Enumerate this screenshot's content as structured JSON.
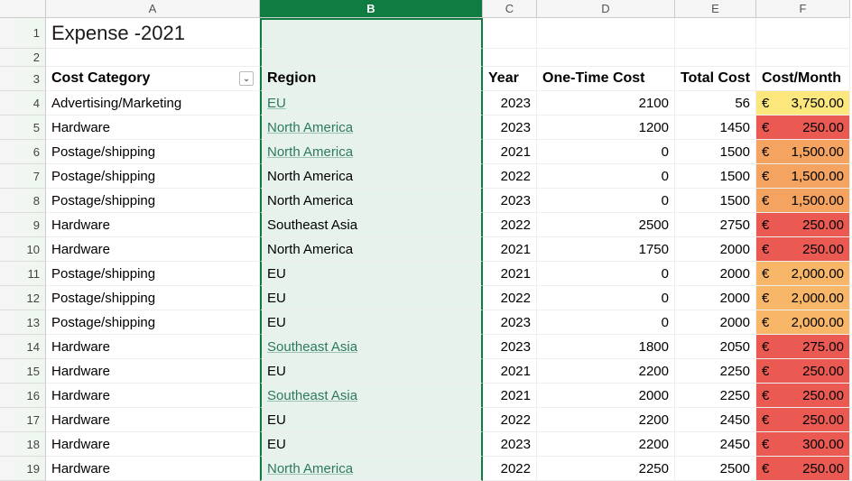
{
  "columns": [
    "A",
    "B",
    "C",
    "D",
    "E",
    "F"
  ],
  "title": "Expense -2021",
  "headers": {
    "costCategory": "Cost Category",
    "region": "Region",
    "year": "Year",
    "oneTimeCost": "One-Time Cost",
    "totalCost": "Total Cost",
    "costMonth": "Cost/Month"
  },
  "currencySymbol": "€",
  "rows": [
    {
      "n": 4,
      "cat": "Advertising/Marketing",
      "region": "EU ",
      "link": true,
      "year": 2023,
      "otc": 2100,
      "tc": 56,
      "cm": "3,750.00",
      "bg": "#fce77d"
    },
    {
      "n": 5,
      "cat": "Hardware",
      "region": "North America ",
      "link": true,
      "year": 2023,
      "otc": 1200,
      "tc": 1450,
      "cm": "250.00",
      "bg": "#ea5a53"
    },
    {
      "n": 6,
      "cat": "Postage/shipping",
      "region": "North America ",
      "link": true,
      "year": 2021,
      "otc": 0,
      "tc": 1500,
      "cm": "1,500.00",
      "bg": "#f4a460"
    },
    {
      "n": 7,
      "cat": "Postage/shipping",
      "region": "North America",
      "link": false,
      "year": 2022,
      "otc": 0,
      "tc": 1500,
      "cm": "1,500.00",
      "bg": "#f4a460"
    },
    {
      "n": 8,
      "cat": "Postage/shipping",
      "region": "North America",
      "link": false,
      "year": 2023,
      "otc": 0,
      "tc": 1500,
      "cm": "1,500.00",
      "bg": "#f4a460"
    },
    {
      "n": 9,
      "cat": "Hardware",
      "region": "Southeast Asia",
      "link": false,
      "year": 2022,
      "otc": 2500,
      "tc": 2750,
      "cm": "250.00",
      "bg": "#ea5a53"
    },
    {
      "n": 10,
      "cat": "Hardware",
      "region": "North America",
      "link": false,
      "year": 2021,
      "otc": 1750,
      "tc": 2000,
      "cm": "250.00",
      "bg": "#ea5a53"
    },
    {
      "n": 11,
      "cat": "Postage/shipping",
      "region": "EU",
      "link": false,
      "year": 2021,
      "otc": 0,
      "tc": 2000,
      "cm": "2,000.00",
      "bg": "#f8b768"
    },
    {
      "n": 12,
      "cat": "Postage/shipping",
      "region": "EU",
      "link": false,
      "year": 2022,
      "otc": 0,
      "tc": 2000,
      "cm": "2,000.00",
      "bg": "#f8b768"
    },
    {
      "n": 13,
      "cat": "Postage/shipping",
      "region": "EU",
      "link": false,
      "year": 2023,
      "otc": 0,
      "tc": 2000,
      "cm": "2,000.00",
      "bg": "#f8b768"
    },
    {
      "n": 14,
      "cat": "Hardware",
      "region": "Southeast Asia ",
      "link": true,
      "year": 2023,
      "otc": 1800,
      "tc": 2050,
      "cm": "275.00",
      "bg": "#ea5a53"
    },
    {
      "n": 15,
      "cat": "Hardware",
      "region": "EU",
      "link": false,
      "year": 2021,
      "otc": 2200,
      "tc": 2250,
      "cm": "250.00",
      "bg": "#ea5a53"
    },
    {
      "n": 16,
      "cat": "Hardware",
      "region": "Southeast Asia ",
      "link": true,
      "year": 2021,
      "otc": 2000,
      "tc": 2250,
      "cm": "250.00",
      "bg": "#ea5a53"
    },
    {
      "n": 17,
      "cat": "Hardware",
      "region": "EU",
      "link": false,
      "year": 2022,
      "otc": 2200,
      "tc": 2450,
      "cm": "250.00",
      "bg": "#ea5a53"
    },
    {
      "n": 18,
      "cat": "Hardware",
      "region": "EU",
      "link": false,
      "year": 2023,
      "otc": 2200,
      "tc": 2450,
      "cm": "300.00",
      "bg": "#ea5a53"
    },
    {
      "n": 19,
      "cat": "Hardware",
      "region": "North America ",
      "link": true,
      "year": 2022,
      "otc": 2250,
      "tc": 2500,
      "cm": "250.00",
      "bg": "#ea5a53"
    }
  ]
}
